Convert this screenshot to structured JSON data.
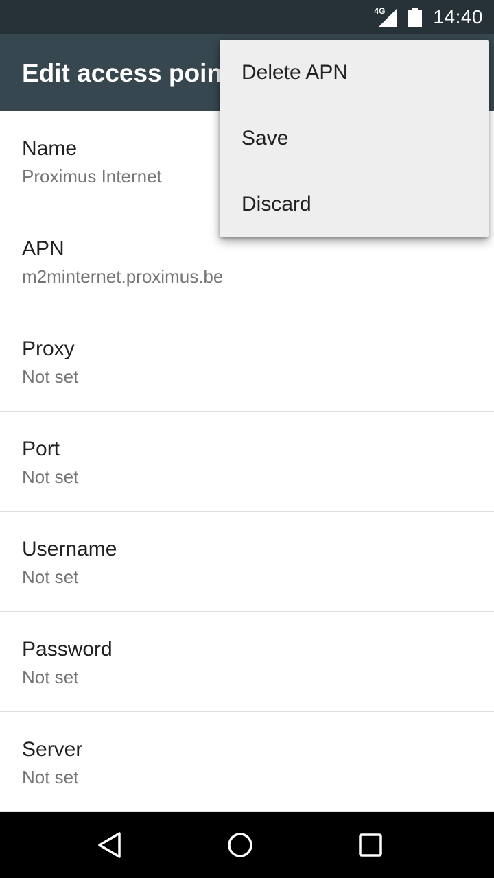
{
  "status_bar": {
    "network_label": "4G",
    "time": "14:40",
    "icons": [
      "signal-icon",
      "battery-icon"
    ]
  },
  "app_bar": {
    "title": "Edit access point"
  },
  "menu": {
    "items": [
      {
        "label": "Delete APN"
      },
      {
        "label": "Save"
      },
      {
        "label": "Discard"
      }
    ]
  },
  "settings": [
    {
      "title": "Name",
      "value": "Proximus Internet"
    },
    {
      "title": "APN",
      "value": "m2minternet.proximus.be"
    },
    {
      "title": "Proxy",
      "value": "Not set"
    },
    {
      "title": "Port",
      "value": "Not set"
    },
    {
      "title": "Username",
      "value": "Not set"
    },
    {
      "title": "Password",
      "value": "Not set"
    },
    {
      "title": "Server",
      "value": "Not set"
    }
  ],
  "nav_bar": {
    "icons": [
      "back-icon",
      "home-icon",
      "recents-icon"
    ]
  },
  "colors": {
    "status_bar": "#263238",
    "app_bar": "#37474f",
    "menu_bg": "#eeeeee",
    "nav_bar": "#000000"
  }
}
